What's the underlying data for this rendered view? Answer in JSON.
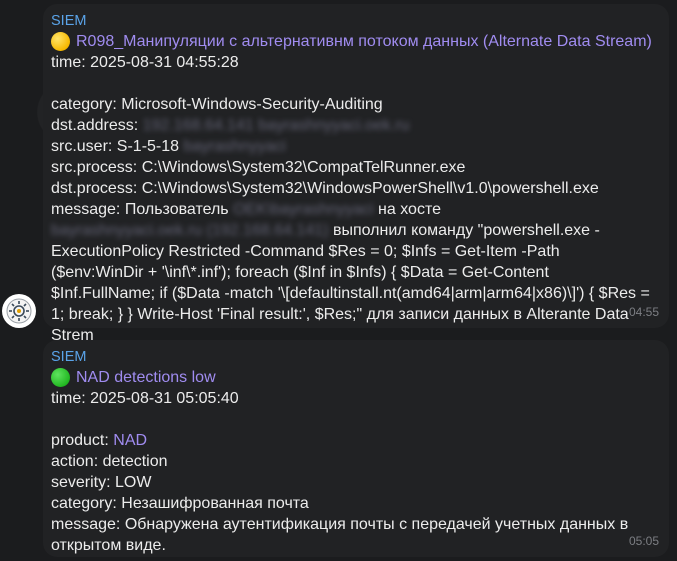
{
  "messages": [
    {
      "sender": "SIEM",
      "title": "R098_Манипуляции с альтернативнм потоком данных (Alternate Data Stream)",
      "time_line": "time: 2025-08-31 04:55:28",
      "category": "category: Microsoft-Windows-Security-Auditing",
      "dst_address_label": "dst.address: ",
      "dst_address_blur": "192.168.64.141",
      "dst_address_host": "bayrashnyyaci.oek.ru",
      "src_user_label": "src.user: S-1-5-18",
      "src_user_blur": "bayrashnyyaci",
      "src_process": "src.process: C:\\Windows\\System32\\CompatTelRunner.exe",
      "dst_process": "dst.process: C:\\Windows\\System32\\WindowsPowerShell\\v1.0\\powershell.exe",
      "message_label": "message: Пользователь ",
      "message_user_blur": "OEK\\bayrashnyyaci",
      "message_host_label": " на хосте ",
      "message_host_blur": "bayrashnyyaci.oek.ru (192.168.64.141)",
      "message_rest": " выполнил команду \"powershell.exe -ExecutionPolicy Restricted -Command $Res = 0; $Infs = Get-Item -Path ($env:WinDir + '\\inf\\*.inf'); foreach ($Inf in $Infs) { $Data = Get-Content $Inf.FullName; if ($Data -match '\\[defaultinstall.nt(amd64|arm|arm64|x86)\\]') { $Res = 1; break; } } Write-Host 'Final result:', $Res;\" для записи данных в Alterante Data Strem",
      "timestamp": "04:55",
      "status_color": "yellow"
    },
    {
      "sender": "SIEM",
      "title": "NAD detections low",
      "time_line": "time: 2025-08-31 05:05:40",
      "product_label": "product: ",
      "product_value": "NAD",
      "action": "action: detection",
      "severity": "severity: LOW",
      "category": "category: Незашифрованная почта",
      "message": "message: Обнаружена аутентификация почты с передачей учетных данных в открытом виде.",
      "timestamp": "05:05",
      "status_color": "green"
    }
  ],
  "avatar": {
    "icon": "bot-gear-icon"
  }
}
